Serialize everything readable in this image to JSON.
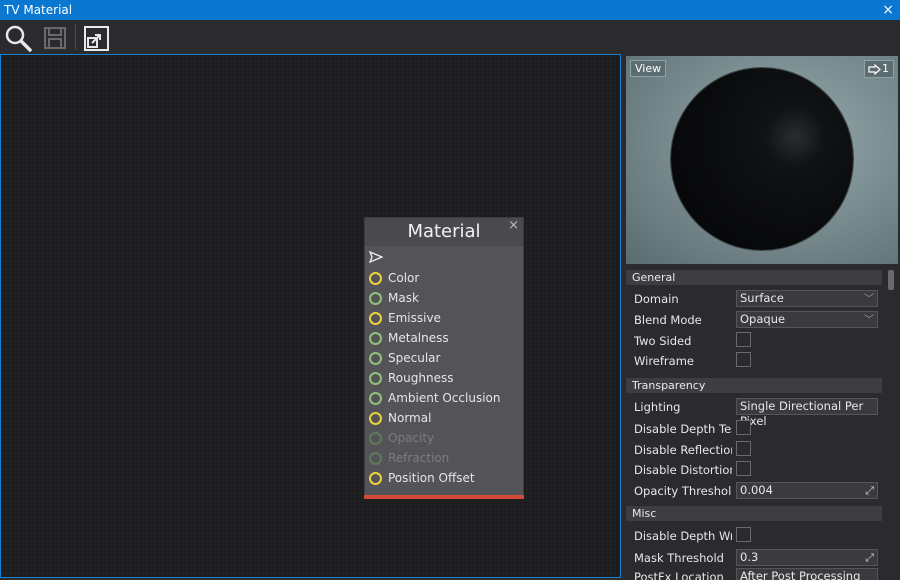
{
  "window": {
    "title": "TV Material",
    "close_glyph": "×"
  },
  "toolbar": {
    "buttons": [
      "search-icon",
      "save-icon",
      "export-icon"
    ]
  },
  "node": {
    "title": "Material",
    "close_glyph": "×",
    "pins": [
      {
        "label": "Color",
        "color": "#e8d43a",
        "enabled": true
      },
      {
        "label": "Mask",
        "color": "#8fc27b",
        "enabled": true
      },
      {
        "label": "Emissive",
        "color": "#e8d43a",
        "enabled": true
      },
      {
        "label": "Metalness",
        "color": "#8fc27b",
        "enabled": true
      },
      {
        "label": "Specular",
        "color": "#8fc27b",
        "enabled": true
      },
      {
        "label": "Roughness",
        "color": "#8fc27b",
        "enabled": true
      },
      {
        "label": "Ambient Occlusion",
        "color": "#8fc27b",
        "enabled": true
      },
      {
        "label": "Normal",
        "color": "#e8d43a",
        "enabled": true
      },
      {
        "label": "Opacity",
        "color": "#5e7a56",
        "enabled": false
      },
      {
        "label": "Refraction",
        "color": "#5e7a56",
        "enabled": false
      },
      {
        "label": "Position Offset",
        "color": "#e8d43a",
        "enabled": true
      }
    ],
    "footer_color": "#d44a3a"
  },
  "preview": {
    "view_label": "View",
    "nav_count": "1"
  },
  "properties": {
    "general": {
      "header": "General",
      "domain": {
        "label": "Domain",
        "value": "Surface"
      },
      "blend_mode": {
        "label": "Blend Mode",
        "value": "Opaque"
      },
      "two_sided": {
        "label": "Two Sided"
      },
      "wireframe": {
        "label": "Wireframe"
      }
    },
    "transparency": {
      "header": "Transparency",
      "lighting": {
        "label": "Lighting",
        "value": "Single Directional Per Pixel"
      },
      "disable_depth_test": {
        "label": "Disable Depth Test"
      },
      "disable_reflections": {
        "label": "Disable Reflections"
      },
      "disable_distortion": {
        "label": "Disable Distortion"
      },
      "opacity_threshold": {
        "label": "Opacity Threshold",
        "value": "0.004"
      }
    },
    "misc": {
      "header": "Misc",
      "disable_depth_write": {
        "label": "Disable Depth Write"
      },
      "mask_threshold": {
        "label": "Mask Threshold",
        "value": "0.3"
      },
      "postfx_location": {
        "label": "PostFx Location",
        "value": "After Post Processing Pass"
      }
    }
  }
}
